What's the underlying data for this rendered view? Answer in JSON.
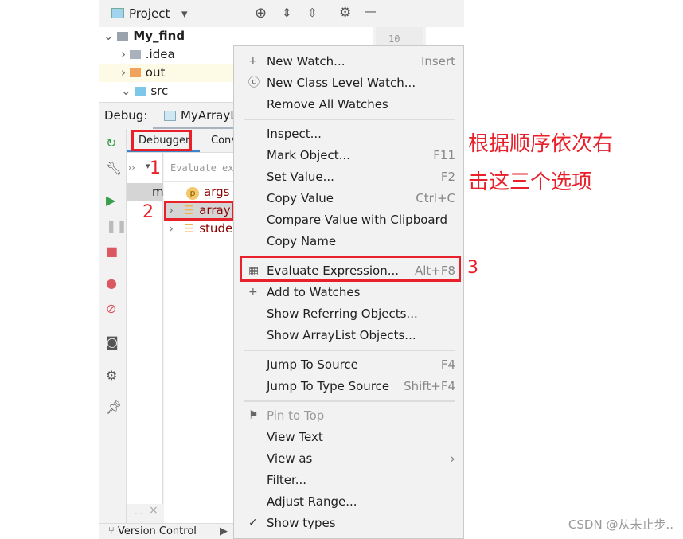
{
  "project": {
    "title": "Project",
    "tree": [
      {
        "label": "My_find",
        "bold": true
      },
      {
        "label": ".idea"
      },
      {
        "label": "out"
      },
      {
        "label": "src"
      }
    ],
    "line_number": "10"
  },
  "debug": {
    "label": "Debug:",
    "config": "MyArrayL",
    "tabs": [
      "Debugger",
      "Cons"
    ],
    "evaluate_placeholder": "Evaluate ex",
    "frame_label": "m",
    "variables": [
      "args",
      "array",
      "stude"
    ],
    "frames_more": "...",
    "version_control": "Version Control"
  },
  "menu": {
    "items": [
      {
        "label": "New Watch...",
        "shortcut": "Insert",
        "icon": "plus-icon"
      },
      {
        "label": "New Class Level Watch...",
        "icon": "class-watch-icon"
      },
      {
        "label": "Remove All Watches"
      },
      {
        "sep": true
      },
      {
        "label": "Inspect..."
      },
      {
        "label": "Mark Object...",
        "shortcut": "F11"
      },
      {
        "label": "Set Value...",
        "shortcut": "F2"
      },
      {
        "label": "Copy Value",
        "shortcut": "Ctrl+C"
      },
      {
        "label": "Compare Value with Clipboard"
      },
      {
        "label": "Copy Name"
      },
      {
        "sep": true
      },
      {
        "label": "Evaluate Expression...",
        "shortcut": "Alt+F8",
        "icon": "calculator-icon",
        "highlighted": true
      },
      {
        "label": "Add to Watches",
        "icon": "add-watch-icon"
      },
      {
        "label": "Show Referring Objects..."
      },
      {
        "label": "Show ArrayList Objects..."
      },
      {
        "sep": true
      },
      {
        "label": "Jump To Source",
        "shortcut": "F4"
      },
      {
        "label": "Jump To Type Source",
        "shortcut": "Shift+F4"
      },
      {
        "sep": true
      },
      {
        "label": "Pin to Top",
        "icon": "flag-icon",
        "disabled": true
      },
      {
        "label": "View Text"
      },
      {
        "label": "View as",
        "submenu": true
      },
      {
        "label": "Filter..."
      },
      {
        "label": "Adjust Range..."
      },
      {
        "label": "Show types",
        "checked": true
      }
    ]
  },
  "annotations": {
    "steps": [
      "1",
      "2",
      "3"
    ],
    "note_line1": "根据顺序依次右",
    "note_line2": "击这三个选项",
    "color": "#e8202a"
  },
  "watermark": "CSDN @从未止步.."
}
